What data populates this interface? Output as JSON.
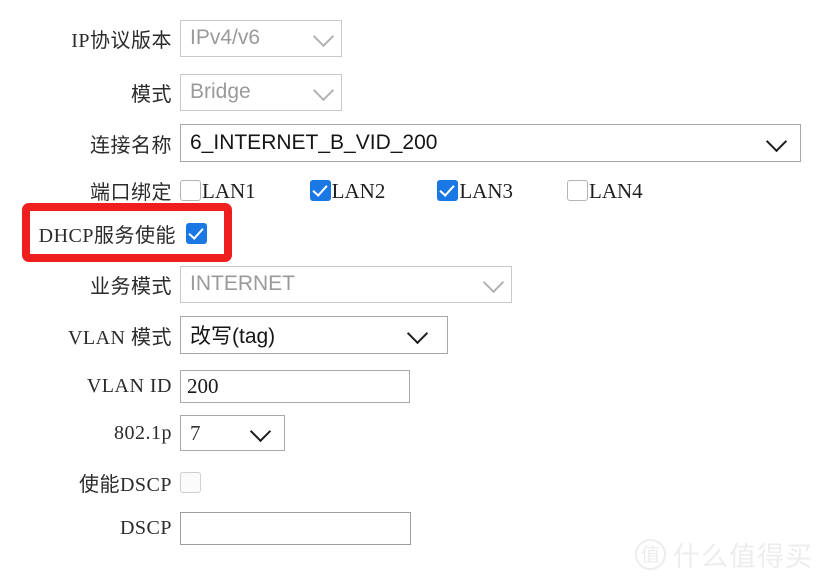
{
  "form": {
    "rows": [
      {
        "label": "IP协议版本",
        "control": "select",
        "value": "IPv4/v6",
        "enabled": false
      },
      {
        "label": "模式",
        "control": "select",
        "value": "Bridge",
        "enabled": false
      },
      {
        "label": "连接名称",
        "control": "select",
        "value": "6_INTERNET_B_VID_200",
        "enabled": true
      },
      {
        "label": "端口绑定",
        "control": "checkbox-group"
      },
      {
        "label": "DHCP服务使能",
        "control": "checkbox",
        "checked": true
      },
      {
        "label": "业务模式",
        "control": "select",
        "value": "INTERNET",
        "enabled": false
      },
      {
        "label": "VLAN 模式",
        "control": "select",
        "value": "改写(tag)",
        "enabled": true
      },
      {
        "label": "VLAN ID",
        "control": "text",
        "value": "200",
        "enabled": true
      },
      {
        "label": "802.1p",
        "control": "select",
        "value": "7",
        "enabled": true
      },
      {
        "label": "使能DSCP",
        "control": "checkbox",
        "checked": false
      },
      {
        "label": "DSCP",
        "control": "text",
        "value": "",
        "enabled": false
      }
    ],
    "port_binding": [
      {
        "label": "LAN1",
        "checked": false
      },
      {
        "label": "LAN2",
        "checked": true
      },
      {
        "label": "LAN3",
        "checked": true
      },
      {
        "label": "LAN4",
        "checked": false
      }
    ]
  },
  "annotation": {
    "highlight_color": "#f01f1f",
    "target_label": "DHCP服务使能"
  },
  "colors": {
    "checkbox_checked": "#1a78e5",
    "disabled_text": "#9a9a9a",
    "enabled_text": "#151515",
    "background": "#ffffff"
  },
  "watermark": {
    "mark": "值",
    "text": "什么值得买"
  }
}
